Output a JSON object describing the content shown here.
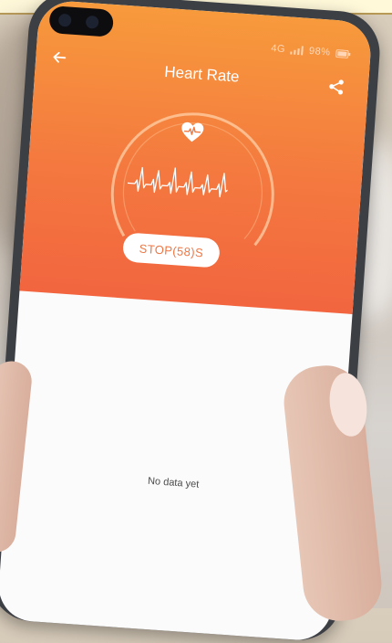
{
  "header": {
    "title": "Heart Rate",
    "back_icon": "arrow-left-icon",
    "share_icon": "share-icon"
  },
  "status_bar": {
    "signal": "4G",
    "battery": "98%"
  },
  "measurement": {
    "heart_icon": "heart-pulse-icon",
    "wave_icon": "ecg-wave-icon",
    "stop_label": "STOP(58)S"
  },
  "content": {
    "empty_text": "No data yet"
  },
  "colors": {
    "gradient_top": "#f79a3c",
    "gradient_bottom": "#f2653f",
    "accent_text": "#f07643"
  }
}
